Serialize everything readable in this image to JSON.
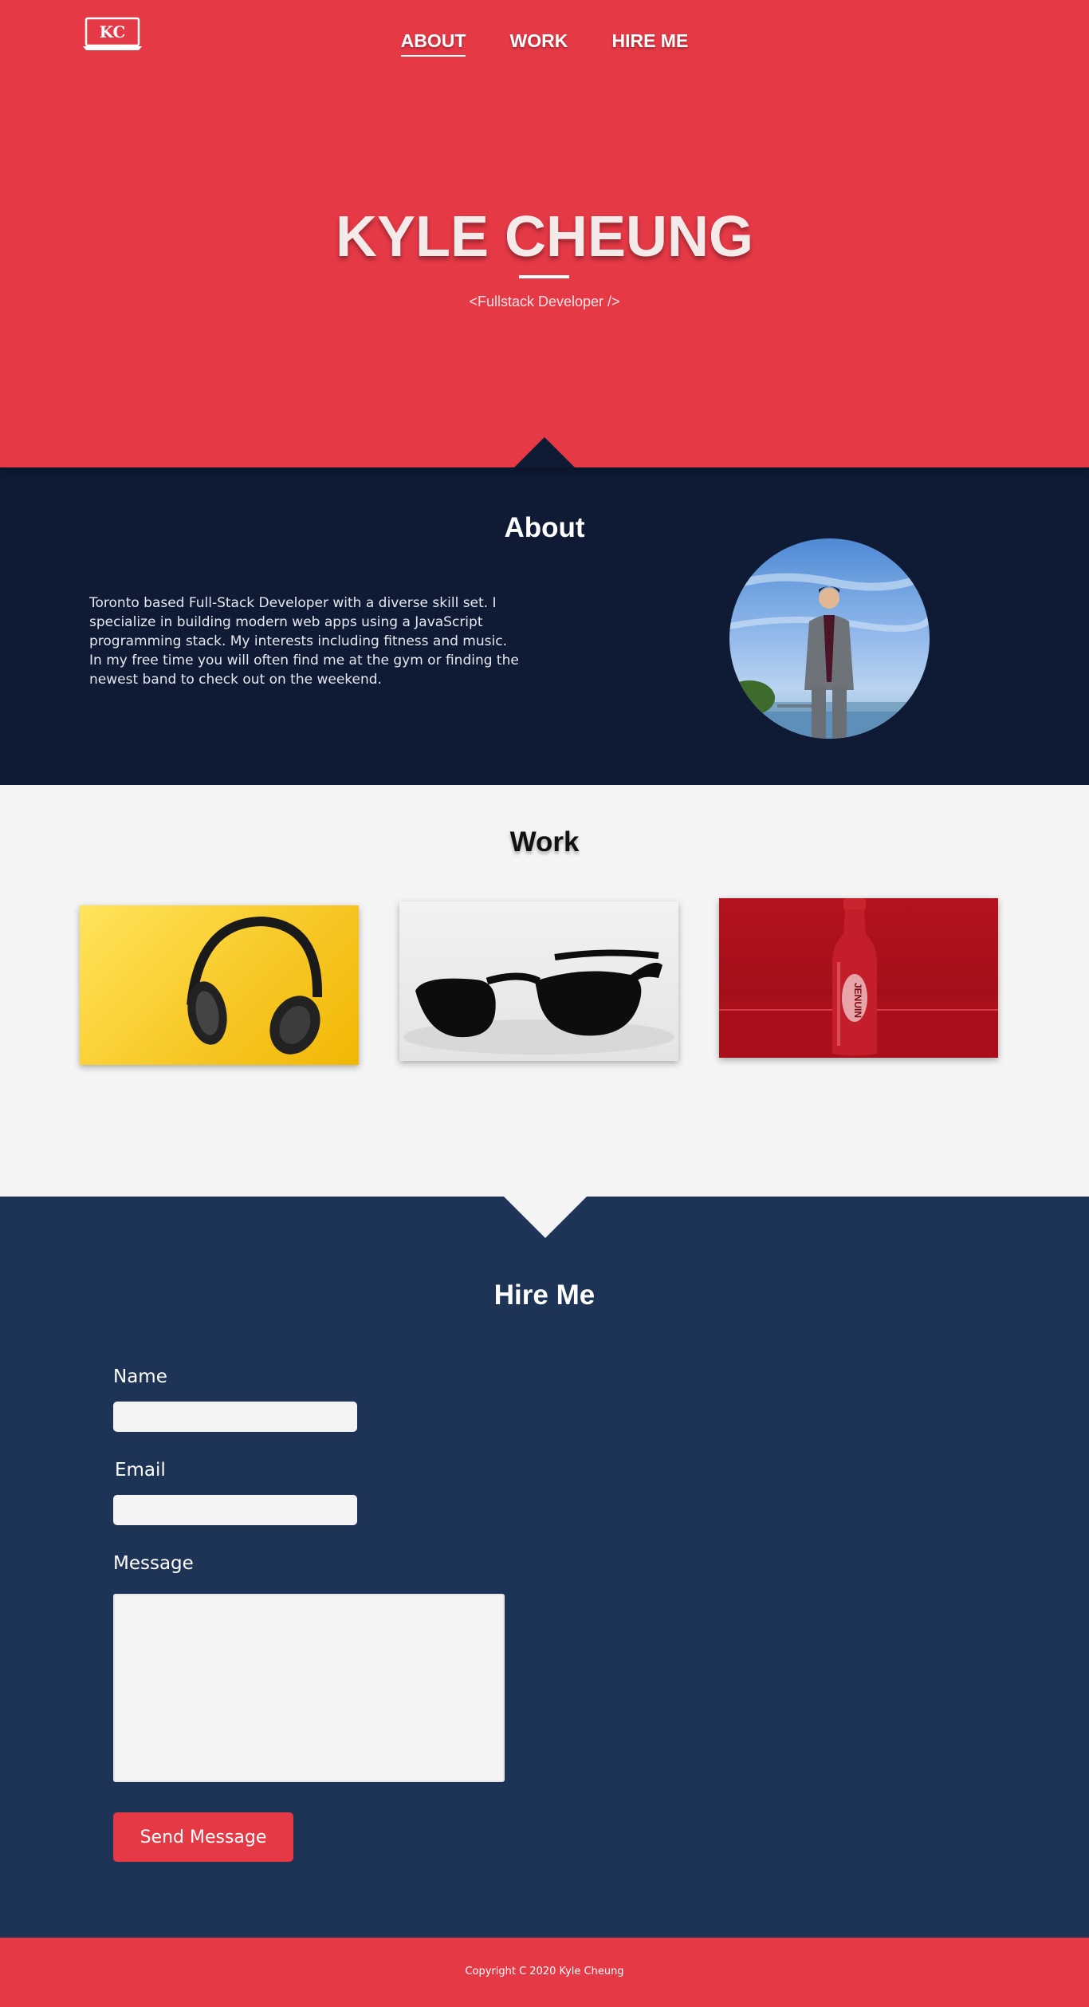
{
  "nav": {
    "logo_text": "KC",
    "items": [
      {
        "label": "ABOUT",
        "active": true
      },
      {
        "label": "WORK",
        "active": false
      },
      {
        "label": "HIRE ME",
        "active": false
      }
    ]
  },
  "hero": {
    "title": "KYLE CHEUNG",
    "subtitle": "<Fullstack Developer />"
  },
  "about": {
    "title": "About",
    "text": "Toronto based Full-Stack Developer with a diverse skill set. I specialize in building modern web apps using a JavaScript programming stack. My interests including fitness and music. In my free time you will often find me at the gym or finding the newest band to check out on the weekend."
  },
  "work": {
    "title": "Work",
    "items": [
      {
        "subject": "headphones"
      },
      {
        "subject": "sunglasses"
      },
      {
        "subject": "bottle",
        "label": "JENUIN"
      }
    ]
  },
  "hire": {
    "title": "Hire Me",
    "name_label": "Name",
    "email_label": "Email",
    "message_label": "Message",
    "name_value": "",
    "email_value": "",
    "message_value": "",
    "send_label": "Send Message"
  },
  "footer": {
    "copyright": "Copyright C 2020 Kyle Cheung"
  },
  "colors": {
    "primary_red": "#e63946",
    "navy": "#0f1b35",
    "hire_blue": "#1d3456",
    "light_gray": "#f4f4f4"
  }
}
